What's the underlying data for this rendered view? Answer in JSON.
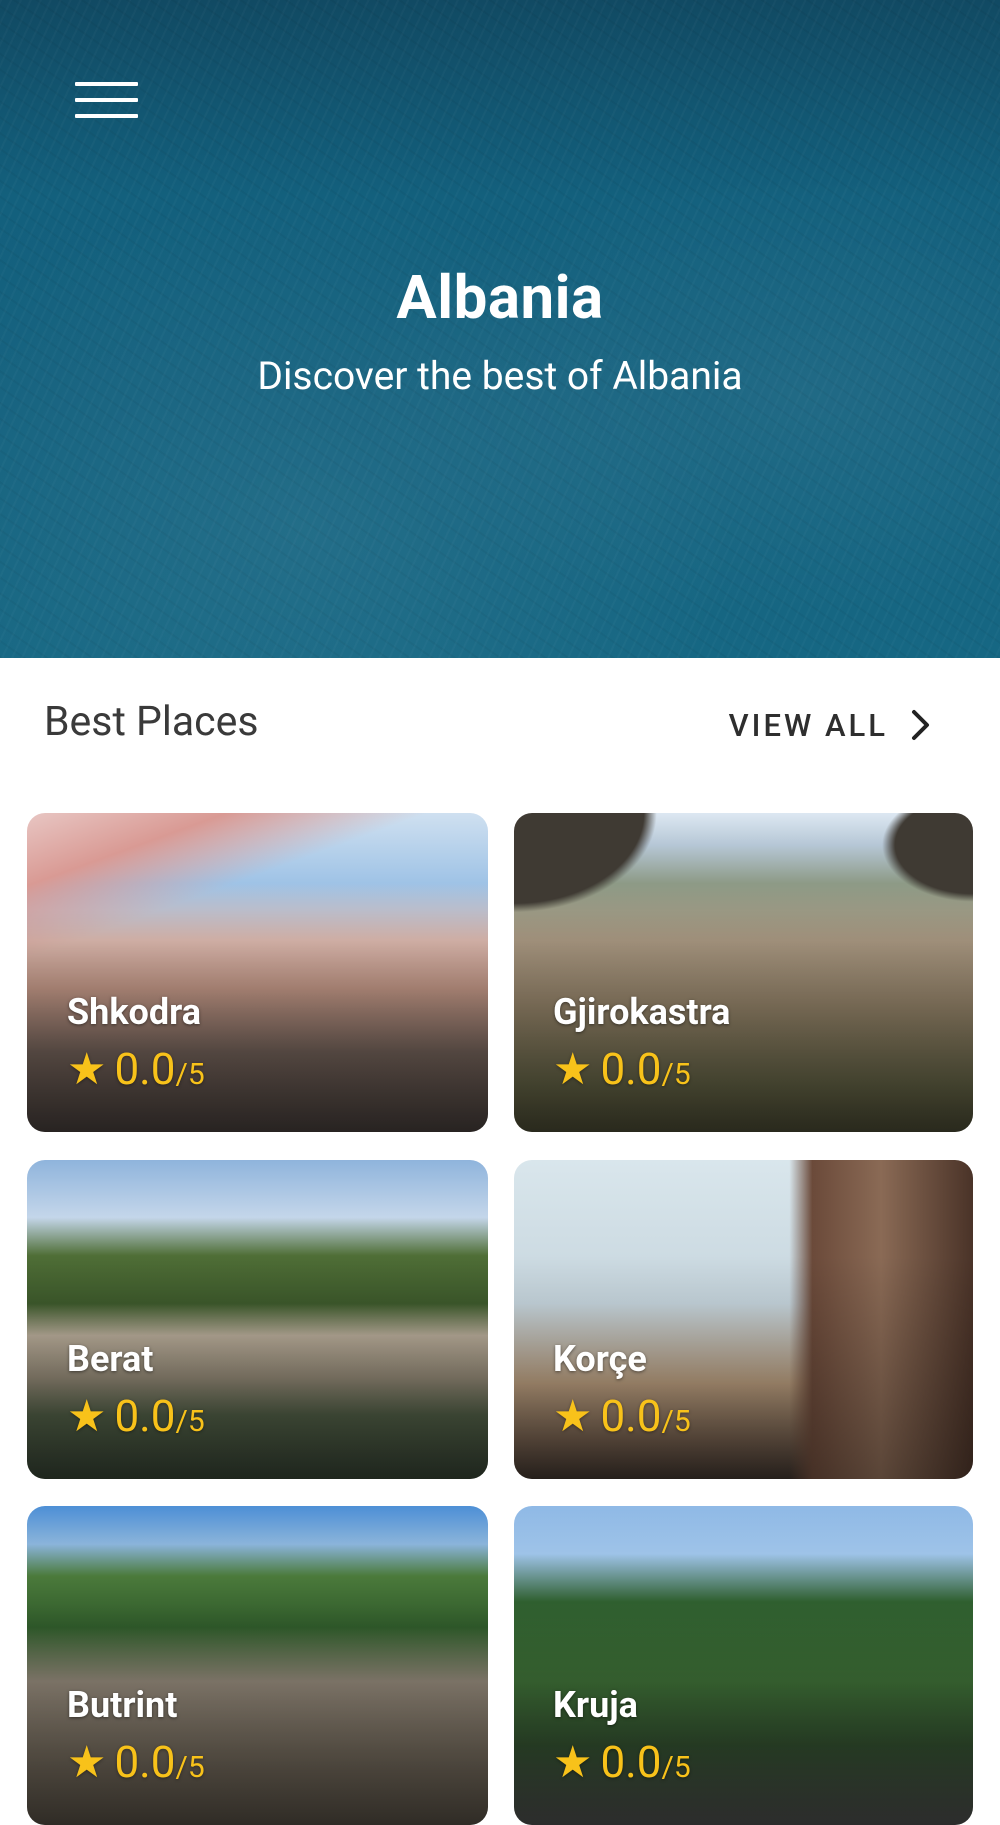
{
  "header": {
    "menu_icon": "hamburger-menu-icon",
    "title": "Albania",
    "subtitle": "Discover the best of Albania",
    "color": "#15627f"
  },
  "section": {
    "title": "Best Places",
    "view_all_label": "VIEW ALL",
    "view_all_icon": "chevron-right-icon"
  },
  "rating_star_color": "#f8c21a",
  "places": [
    {
      "name": "Shkodra",
      "rating": "0.0",
      "max": "/5"
    },
    {
      "name": "Gjirokastra",
      "rating": "0.0",
      "max": "/5"
    },
    {
      "name": "Berat",
      "rating": "0.0",
      "max": "/5"
    },
    {
      "name": "Korçe",
      "rating": "0.0",
      "max": "/5"
    },
    {
      "name": "Butrint",
      "rating": "0.0",
      "max": "/5"
    },
    {
      "name": "Kruja",
      "rating": "0.0",
      "max": "/5"
    }
  ]
}
